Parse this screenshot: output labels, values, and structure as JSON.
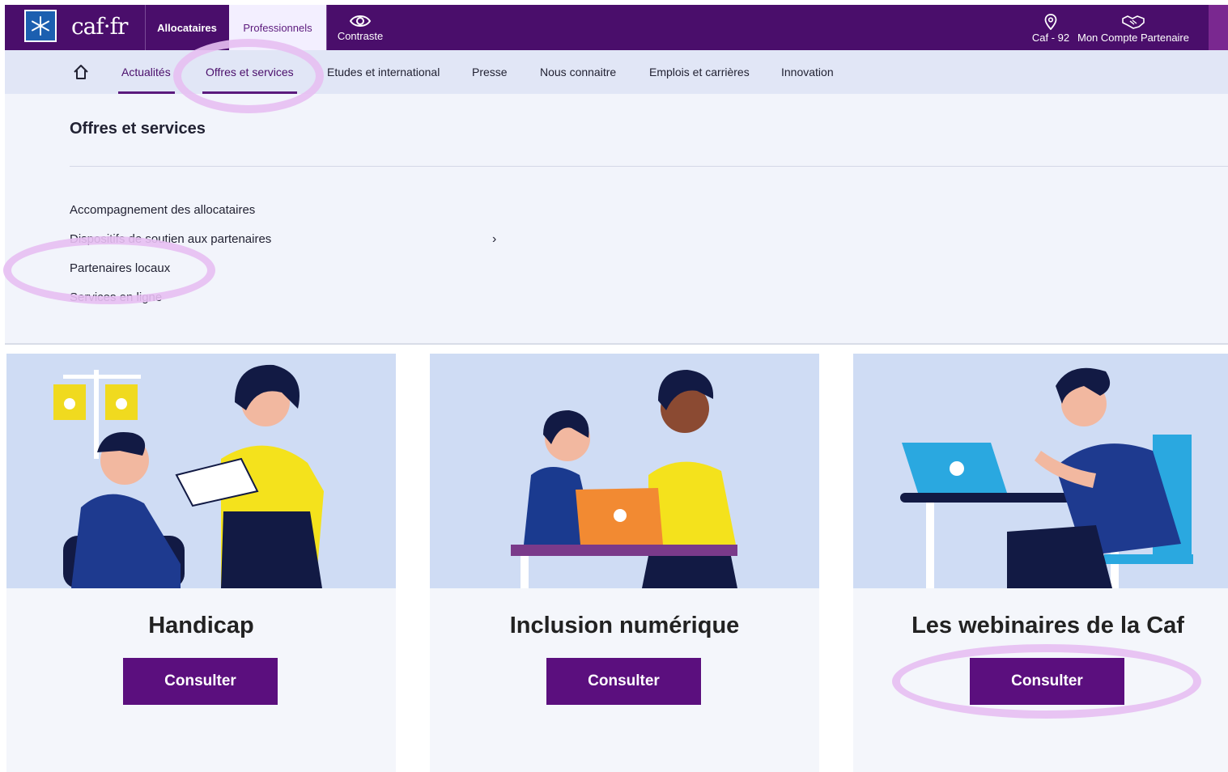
{
  "header": {
    "logo_text": "caf·fr",
    "tabs": [
      {
        "label": "Allocataires",
        "active": false
      },
      {
        "label": "Professionnels",
        "active": true
      }
    ],
    "contrast_label": "Contraste",
    "location_label": "Caf - 92",
    "account_label": "Mon Compte Partenaire"
  },
  "subnav": {
    "items": [
      {
        "label": "Actualités",
        "selected": true
      },
      {
        "label": "Offres et services",
        "selected": true
      },
      {
        "label": "Etudes et international",
        "selected": false
      },
      {
        "label": "Presse",
        "selected": false
      },
      {
        "label": "Nous connaitre",
        "selected": false
      },
      {
        "label": "Emplois et carrières",
        "selected": false
      },
      {
        "label": "Innovation",
        "selected": false
      }
    ]
  },
  "dropdown": {
    "title": "Offres et services",
    "links": [
      "Accompagnement des allocataires",
      "Dispositifs de soutien aux partenaires",
      "Partenaires locaux",
      "Services en ligne"
    ]
  },
  "cards": [
    {
      "title": "Handicap",
      "button": "Consulter"
    },
    {
      "title": "Inclusion numérique",
      "button": "Consulter"
    },
    {
      "title": "Les webinaires de la Caf",
      "button": "Consulter"
    }
  ],
  "colors": {
    "brand_purple": "#4a0e6b",
    "button_purple": "#5b0f7e",
    "highlight_ellipse": "#e7bff2",
    "illustration_bg": "#cfdcf4"
  }
}
